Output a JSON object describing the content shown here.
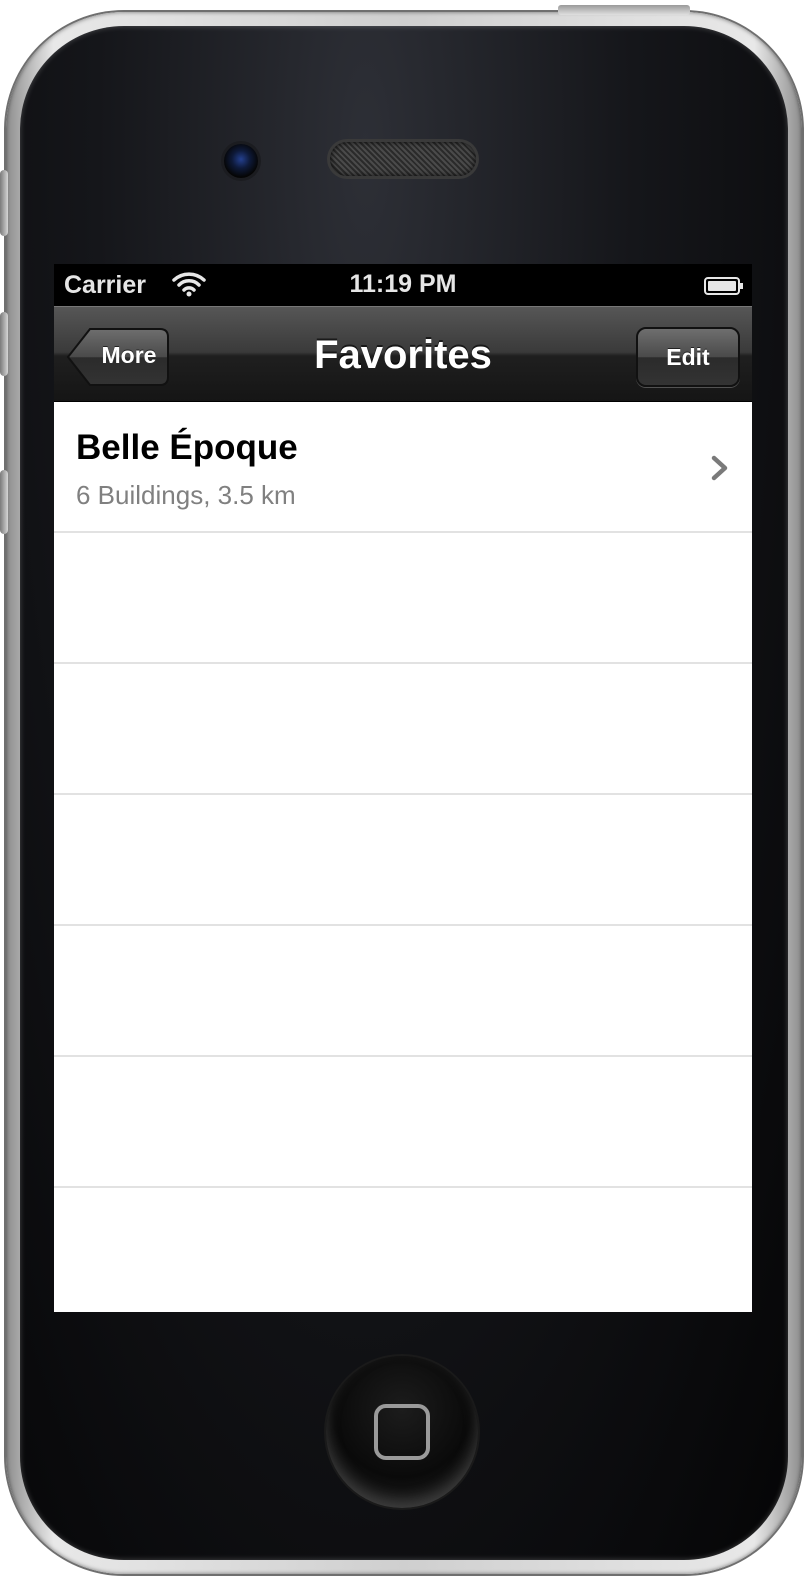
{
  "status_bar": {
    "carrier": "Carrier",
    "time": "11:19 PM",
    "wifi_icon": "wifi-icon",
    "battery_icon": "battery-icon"
  },
  "navbar": {
    "back_label": "More",
    "title": "Favorites",
    "edit_label": "Edit"
  },
  "list": {
    "items": [
      {
        "title": "Belle Époque",
        "subtitle": "6 Buildings, 3.5 km",
        "accessory": "chevron-right-icon"
      }
    ]
  },
  "colors": {
    "navbar": "#2a2a2a",
    "status_bar": "#000000",
    "subtitle_text": "#808080",
    "separator": "#e2e2e2"
  }
}
